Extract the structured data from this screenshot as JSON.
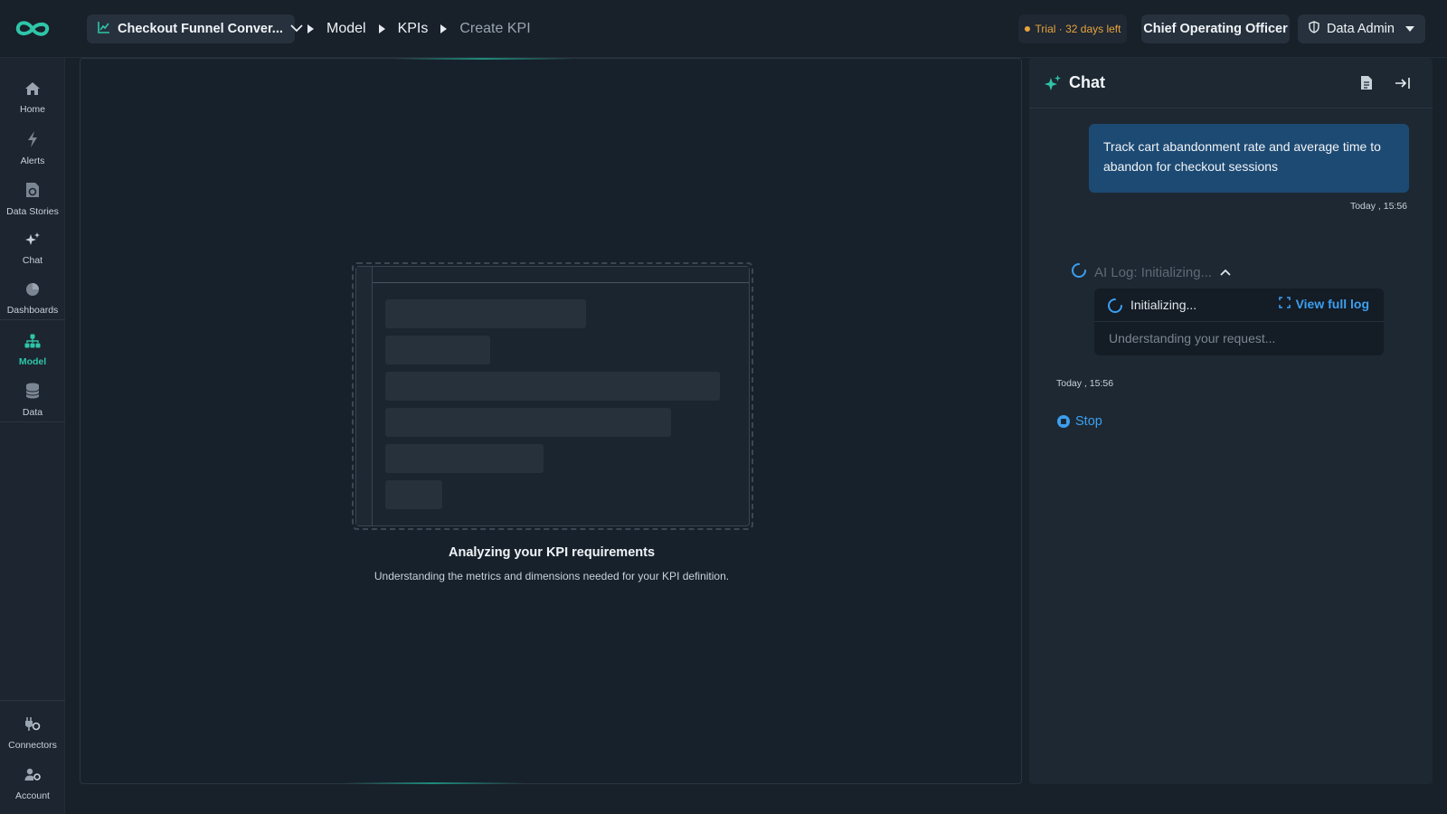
{
  "topbar": {
    "project_label": "Checkout Funnel Conver...",
    "breadcrumbs": [
      {
        "label": "Model"
      },
      {
        "label": "KPIs"
      },
      {
        "label": "Create KPI"
      }
    ],
    "trial_label": "Trial · 32 days left",
    "role_label": "Chief Operating Officer",
    "admin_label": "Data Admin"
  },
  "sidebar": {
    "items": [
      {
        "label": "Home",
        "icon": "home-icon"
      },
      {
        "label": "Alerts",
        "icon": "lightning-icon"
      },
      {
        "label": "Data Stories",
        "icon": "story-icon"
      },
      {
        "label": "Chat",
        "icon": "sparkle-icon"
      },
      {
        "label": "Dashboards",
        "icon": "pie-icon"
      },
      {
        "label": "Model",
        "icon": "hierarchy-icon"
      },
      {
        "label": "Data",
        "icon": "database-icon"
      }
    ],
    "bottom_items": [
      {
        "label": "Connectors",
        "icon": "plug-icon"
      },
      {
        "label": "Account",
        "icon": "user-gear-icon"
      }
    ]
  },
  "main": {
    "title": "Analyzing your KPI requirements",
    "subtitle": "Understanding the metrics and dimensions needed for your KPI definition."
  },
  "chat": {
    "title": "Chat",
    "user_message": "Track cart abandonment rate and average time to abandon for checkout sessions",
    "user_timestamp": "Today , 15:56",
    "ai_log_label": "AI Log: Initializing...",
    "log_status": "Initializing...",
    "view_full_log": "View full log",
    "log_detail": "Understanding your request...",
    "ai_timestamp": "Today , 15:56",
    "stop_label": "Stop"
  },
  "colors": {
    "accent": "#2fc5a8",
    "link": "#3c9ff0",
    "trial": "#e8a33c",
    "user_bubble": "#1d4a73"
  }
}
